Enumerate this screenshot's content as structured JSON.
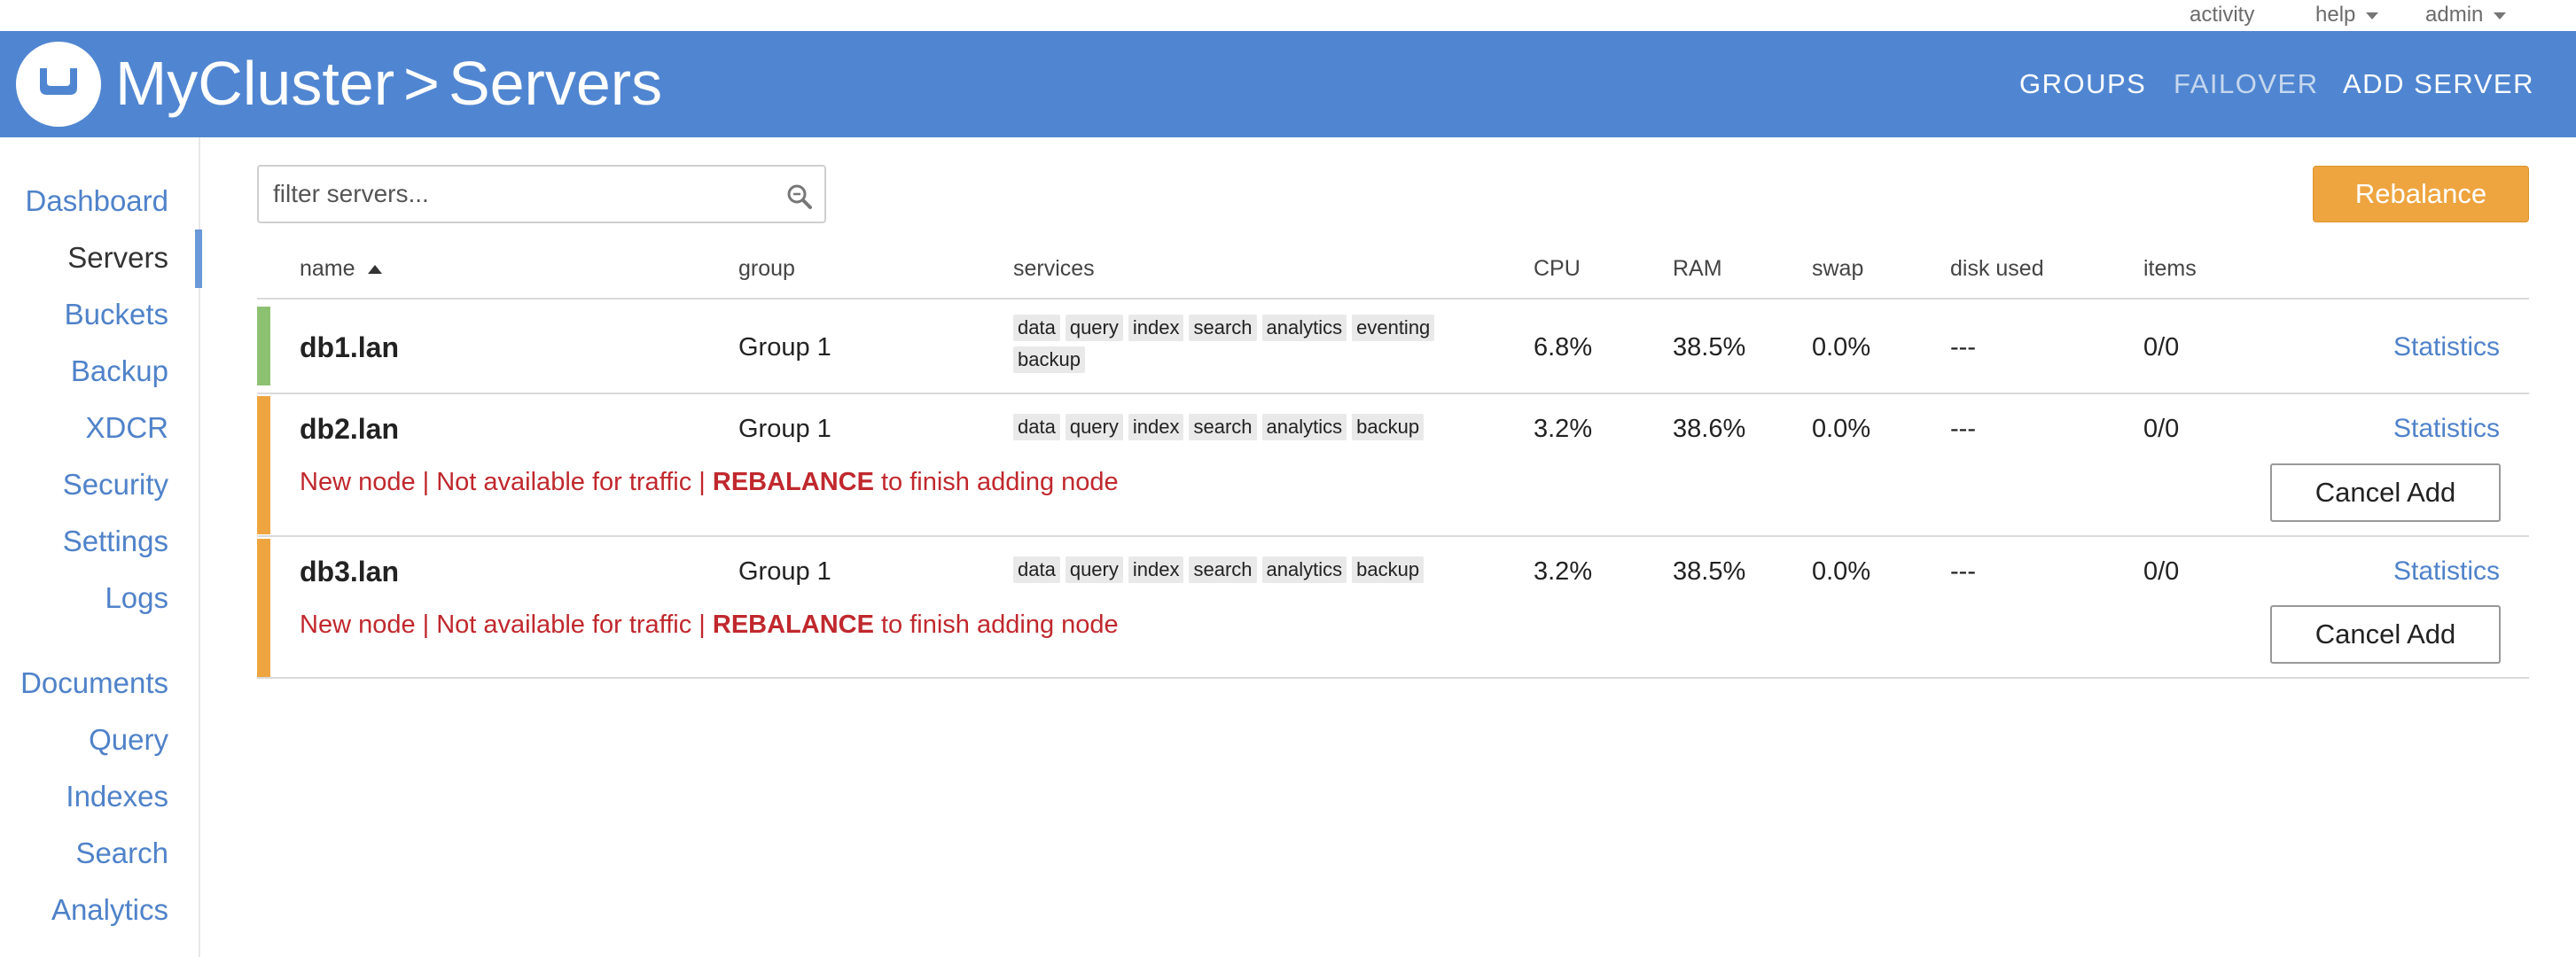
{
  "topbar": {
    "activity": "activity",
    "help": "help",
    "admin": "admin"
  },
  "header": {
    "cluster": "MyCluster",
    "separator": ">",
    "page": "Servers",
    "nav": {
      "groups": "GROUPS",
      "failover": "FAILOVER",
      "add_server": "ADD SERVER"
    }
  },
  "sidebar": {
    "items": [
      {
        "label": "Dashboard",
        "active": false
      },
      {
        "label": "Servers",
        "active": true
      },
      {
        "label": "Buckets",
        "active": false
      },
      {
        "label": "Backup",
        "active": false
      },
      {
        "label": "XDCR",
        "active": false
      },
      {
        "label": "Security",
        "active": false
      },
      {
        "label": "Settings",
        "active": false
      },
      {
        "label": "Logs",
        "active": false
      },
      {
        "label": "Documents",
        "active": false
      },
      {
        "label": "Query",
        "active": false
      },
      {
        "label": "Indexes",
        "active": false
      },
      {
        "label": "Search",
        "active": false
      },
      {
        "label": "Analytics",
        "active": false
      }
    ]
  },
  "filter": {
    "placeholder": "filter servers..."
  },
  "rebalance_label": "Rebalance",
  "table": {
    "columns": {
      "name": "name",
      "group": "group",
      "services": "services",
      "cpu": "CPU",
      "ram": "RAM",
      "swap": "swap",
      "disk_used": "disk used",
      "items": "items"
    },
    "rows": [
      {
        "name": "db1.lan",
        "group": "Group 1",
        "services": [
          "data",
          "query",
          "index",
          "search",
          "analytics",
          "eventing",
          "backup"
        ],
        "cpu": "6.8%",
        "ram": "38.5%",
        "swap": "0.0%",
        "disk_used": "---",
        "items": "0/0",
        "stats_label": "Statistics",
        "status_color": "#8dc172"
      },
      {
        "name": "db2.lan",
        "group": "Group 1",
        "services": [
          "data",
          "query",
          "index",
          "search",
          "analytics",
          "backup"
        ],
        "cpu": "3.2%",
        "ram": "38.6%",
        "swap": "0.0%",
        "disk_used": "---",
        "items": "0/0",
        "stats_label": "Statistics",
        "status_color": "#eea540",
        "warning": {
          "prefix": "New node | Not available for traffic | ",
          "emphasis": "REBALANCE",
          "suffix": " to finish adding node"
        },
        "cancel_label": "Cancel Add"
      },
      {
        "name": "db3.lan",
        "group": "Group 1",
        "services": [
          "data",
          "query",
          "index",
          "search",
          "analytics",
          "backup"
        ],
        "cpu": "3.2%",
        "ram": "38.5%",
        "swap": "0.0%",
        "disk_used": "---",
        "items": "0/0",
        "stats_label": "Statistics",
        "status_color": "#eea540",
        "warning": {
          "prefix": "New node | Not available for traffic | ",
          "emphasis": "REBALANCE",
          "suffix": " to finish adding node"
        },
        "cancel_label": "Cancel Add"
      }
    ]
  },
  "colors": {
    "header": "#5086d1",
    "link": "#4f82c9",
    "rebalance": "#eea540",
    "healthy": "#8dc172",
    "warning_text": "#c0282d"
  }
}
